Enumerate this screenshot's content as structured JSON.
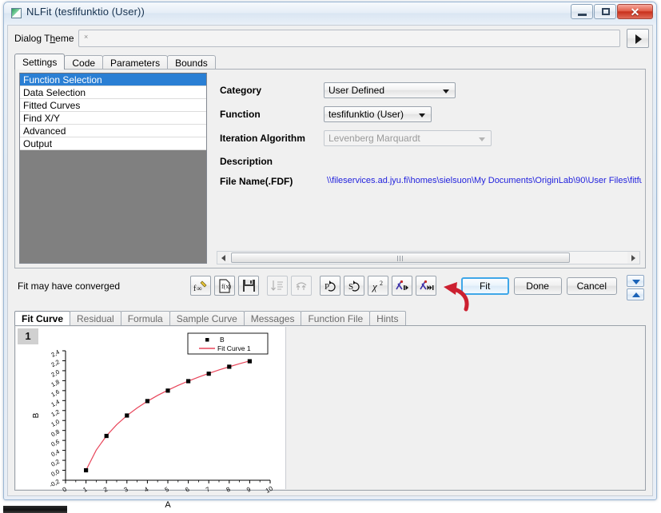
{
  "window": {
    "title": "NLFit (tesfifunktio (User))",
    "icon": "app-icon",
    "buttons": {
      "minimize": "–",
      "maximize": "□",
      "close": "✕"
    }
  },
  "theme": {
    "label_pre": "Dialog T",
    "label_accel": "h",
    "label_post": "eme",
    "value": "×",
    "arrow_icon": "play-arrow-icon"
  },
  "top_tabs": [
    {
      "label": "Settings",
      "active": true
    },
    {
      "label": "Code",
      "active": false
    },
    {
      "label": "Parameters",
      "active": false
    },
    {
      "label": "Bounds",
      "active": false
    }
  ],
  "tree": {
    "items": [
      {
        "label": "Function Selection",
        "selected": true
      },
      {
        "label": "Data Selection",
        "selected": false
      },
      {
        "label": "Fitted Curves",
        "selected": false
      },
      {
        "label": "Find X/Y",
        "selected": false
      },
      {
        "label": "Advanced",
        "selected": false
      },
      {
        "label": "Output",
        "selected": false
      }
    ]
  },
  "form": {
    "category": {
      "label": "Category",
      "value": "User Defined"
    },
    "function": {
      "label": "Function",
      "value": "tesfifunktio (User)"
    },
    "algorithm": {
      "label": "Iteration Algorithm",
      "value": "Levenberg Marquardt",
      "disabled": true
    },
    "description": {
      "label": "Description",
      "value": ""
    },
    "filename": {
      "label": "File Name(.FDF)",
      "value": "\\\\fileservices.ad.jyu.fi\\homes\\sielsuon\\My Documents\\OriginLab\\90\\User Files\\fitfu",
      "color": "#2222dd"
    }
  },
  "status": {
    "message": "Fit may have converged"
  },
  "toolbar": {
    "buttons": [
      {
        "name": "edit-function-icon",
        "glyph": "f∞",
        "disabled": false
      },
      {
        "name": "function-file-icon",
        "glyph": "f",
        "disabled": false
      },
      {
        "name": "save-icon",
        "glyph": "💾",
        "disabled": false
      },
      {
        "name": "initialize-parameters-icon",
        "glyph": "↓",
        "disabled": true
      },
      {
        "name": "approximate-icon",
        "glyph": "↑",
        "disabled": true
      },
      {
        "name": "undo-fit-p-icon",
        "glyph": "P",
        "disabled": false
      },
      {
        "name": "undo-fit-s-icon",
        "glyph": "S",
        "disabled": false
      },
      {
        "name": "chi-square-icon",
        "glyph": "χ²",
        "disabled": false
      },
      {
        "name": "one-iteration-icon",
        "glyph": "λ",
        "disabled": false
      },
      {
        "name": "fit-until-converged-icon",
        "glyph": "λ",
        "disabled": false
      }
    ],
    "annotation": "red-curved-arrow"
  },
  "actions": {
    "fit": "Fit",
    "done": "Done",
    "cancel": "Cancel",
    "scroll_down": "chevron-down-icon",
    "scroll_up": "chevron-up-icon"
  },
  "bottom_tabs": [
    {
      "label": "Fit Curve",
      "active": true
    },
    {
      "label": "Residual",
      "active": false
    },
    {
      "label": "Formula",
      "active": false
    },
    {
      "label": "Sample Curve",
      "active": false
    },
    {
      "label": "Messages",
      "active": false
    },
    {
      "label": "Function File",
      "active": false
    },
    {
      "label": "Hints",
      "active": false
    }
  ],
  "graph": {
    "page_number": "1"
  },
  "chart_data": {
    "type": "scatter",
    "title": "",
    "xlabel": "A",
    "ylabel": "B",
    "xlim": [
      0,
      10
    ],
    "ylim": [
      -0.2,
      2.4
    ],
    "xticks": [
      0,
      1,
      2,
      3,
      4,
      5,
      6,
      7,
      8,
      9,
      10
    ],
    "xtick_labels": [
      "0",
      "1",
      "2",
      "3",
      "4",
      "5",
      "6",
      "7",
      "8",
      "9",
      "10"
    ],
    "yticks": [
      -0.2,
      0.0,
      0.2,
      0.4,
      0.6,
      0.8,
      1.0,
      1.2,
      1.4,
      1.6,
      1.8,
      2.0,
      2.2,
      2.4
    ],
    "ytick_labels": [
      "-0,2",
      "0,0",
      "0,2",
      "0,4",
      "0,6",
      "0,8",
      "1,0",
      "1,2",
      "1,4",
      "1,6",
      "1,8",
      "2,0",
      "2,2",
      "2,4"
    ],
    "grid": false,
    "legend_position": "top-right",
    "series": [
      {
        "name": "B",
        "kind": "markers",
        "marker": "square",
        "color": "#000000",
        "x": [
          1,
          2,
          3,
          4,
          5,
          6,
          7,
          8,
          9
        ],
        "values": [
          0.0,
          0.69,
          1.1,
          1.39,
          1.6,
          1.79,
          1.94,
          2.08,
          2.19
        ]
      },
      {
        "name": "Fit Curve 1",
        "kind": "line",
        "color": "#e8455a",
        "x": [
          1,
          1.5,
          2,
          2.5,
          3,
          3.5,
          4,
          4.5,
          5,
          5.5,
          6,
          6.5,
          7,
          7.5,
          8,
          8.5,
          9
        ],
        "values": [
          0.0,
          0.405,
          0.693,
          0.916,
          1.099,
          1.253,
          1.386,
          1.504,
          1.609,
          1.705,
          1.792,
          1.872,
          1.946,
          2.015,
          2.079,
          2.14,
          2.197
        ]
      }
    ]
  }
}
